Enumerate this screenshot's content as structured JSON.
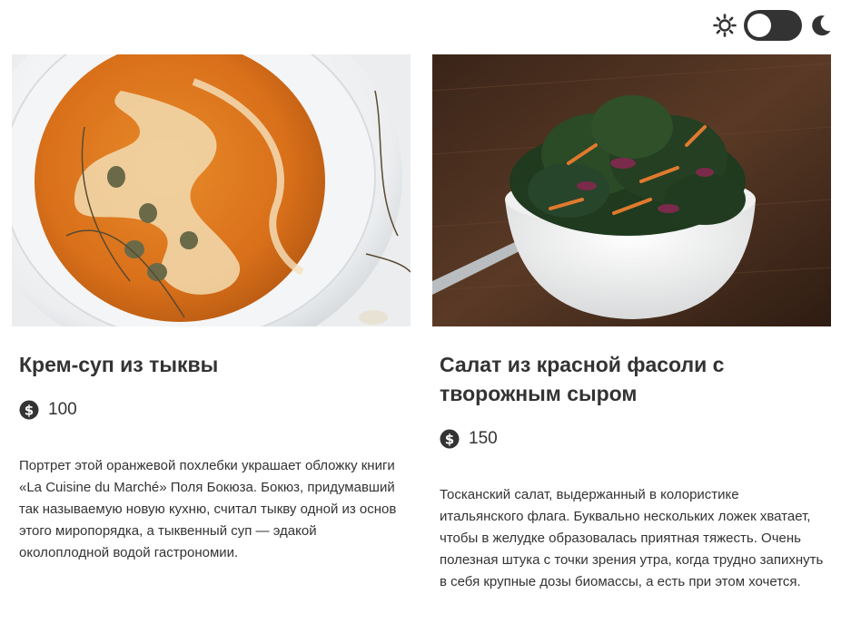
{
  "theme_toggle": {
    "sun_icon": "sun-icon",
    "moon_icon": "moon-icon",
    "state": "light"
  },
  "cards": [
    {
      "image_alt": "pumpkin-soup-photo",
      "title": "Крем-суп из тыквы",
      "price_icon": "dollar-coin-icon",
      "price": "100",
      "description": "Портрет этой оранжевой похлебки украшает обложку книги «La Cuisine du Marché» Поля Бокюза. Бокюз, придумавший так называемую новую кухню, считал тыкву одной из основ этого миропорядка, а тыквенный суп — эдакой околоплодной водой гастрономии."
    },
    {
      "image_alt": "kale-bean-salad-photo",
      "title": "Салат из красной фасоли с творожным сыром",
      "price_icon": "dollar-coin-icon",
      "price": "150",
      "description": "Тосканский салат, выдержанный в колористике итальянского флага. Буквально нескольких ложек хватает, чтобы в желудке образовалась приятная тяжесть. Очень полезная штука с точки зрения утра, когда трудно запихнуть в себя крупные дозы биомассы, а есть при этом хочется."
    }
  ],
  "colors": {
    "text": "#333333",
    "toggle_track": "#333333",
    "toggle_knob": "#ffffff",
    "background": "#ffffff"
  }
}
